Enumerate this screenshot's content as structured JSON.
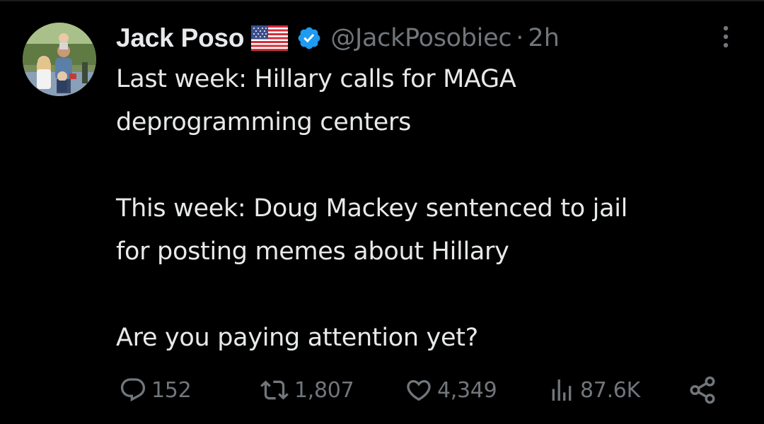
{
  "tweet": {
    "author": {
      "display_name": "Jack Poso",
      "flag_emoji": "us-flag-icon",
      "verified": true,
      "handle": "@JackPosobiec",
      "separator": "·",
      "time": "2h"
    },
    "paragraphs": [
      "Last week: Hillary calls for MAGA\ndeprogramming centers",
      "This week: Doug Mackey sentenced to jail\nfor posting memes about Hillary",
      "Are you paying attention yet?"
    ],
    "actions": {
      "replies": "152",
      "retweets": "1,807",
      "likes": "4,349",
      "views": "87.6K"
    }
  },
  "icons": {
    "reply": "reply-icon",
    "retweet": "retweet-icon",
    "like": "heart-icon",
    "views": "views-icon",
    "share": "share-icon",
    "more": "more-icon",
    "verified": "verified-badge-icon"
  },
  "colors": {
    "background": "#000000",
    "text_primary": "#e7e9ea",
    "text_secondary": "#71767b",
    "verified_blue": "#1d9bf0"
  }
}
